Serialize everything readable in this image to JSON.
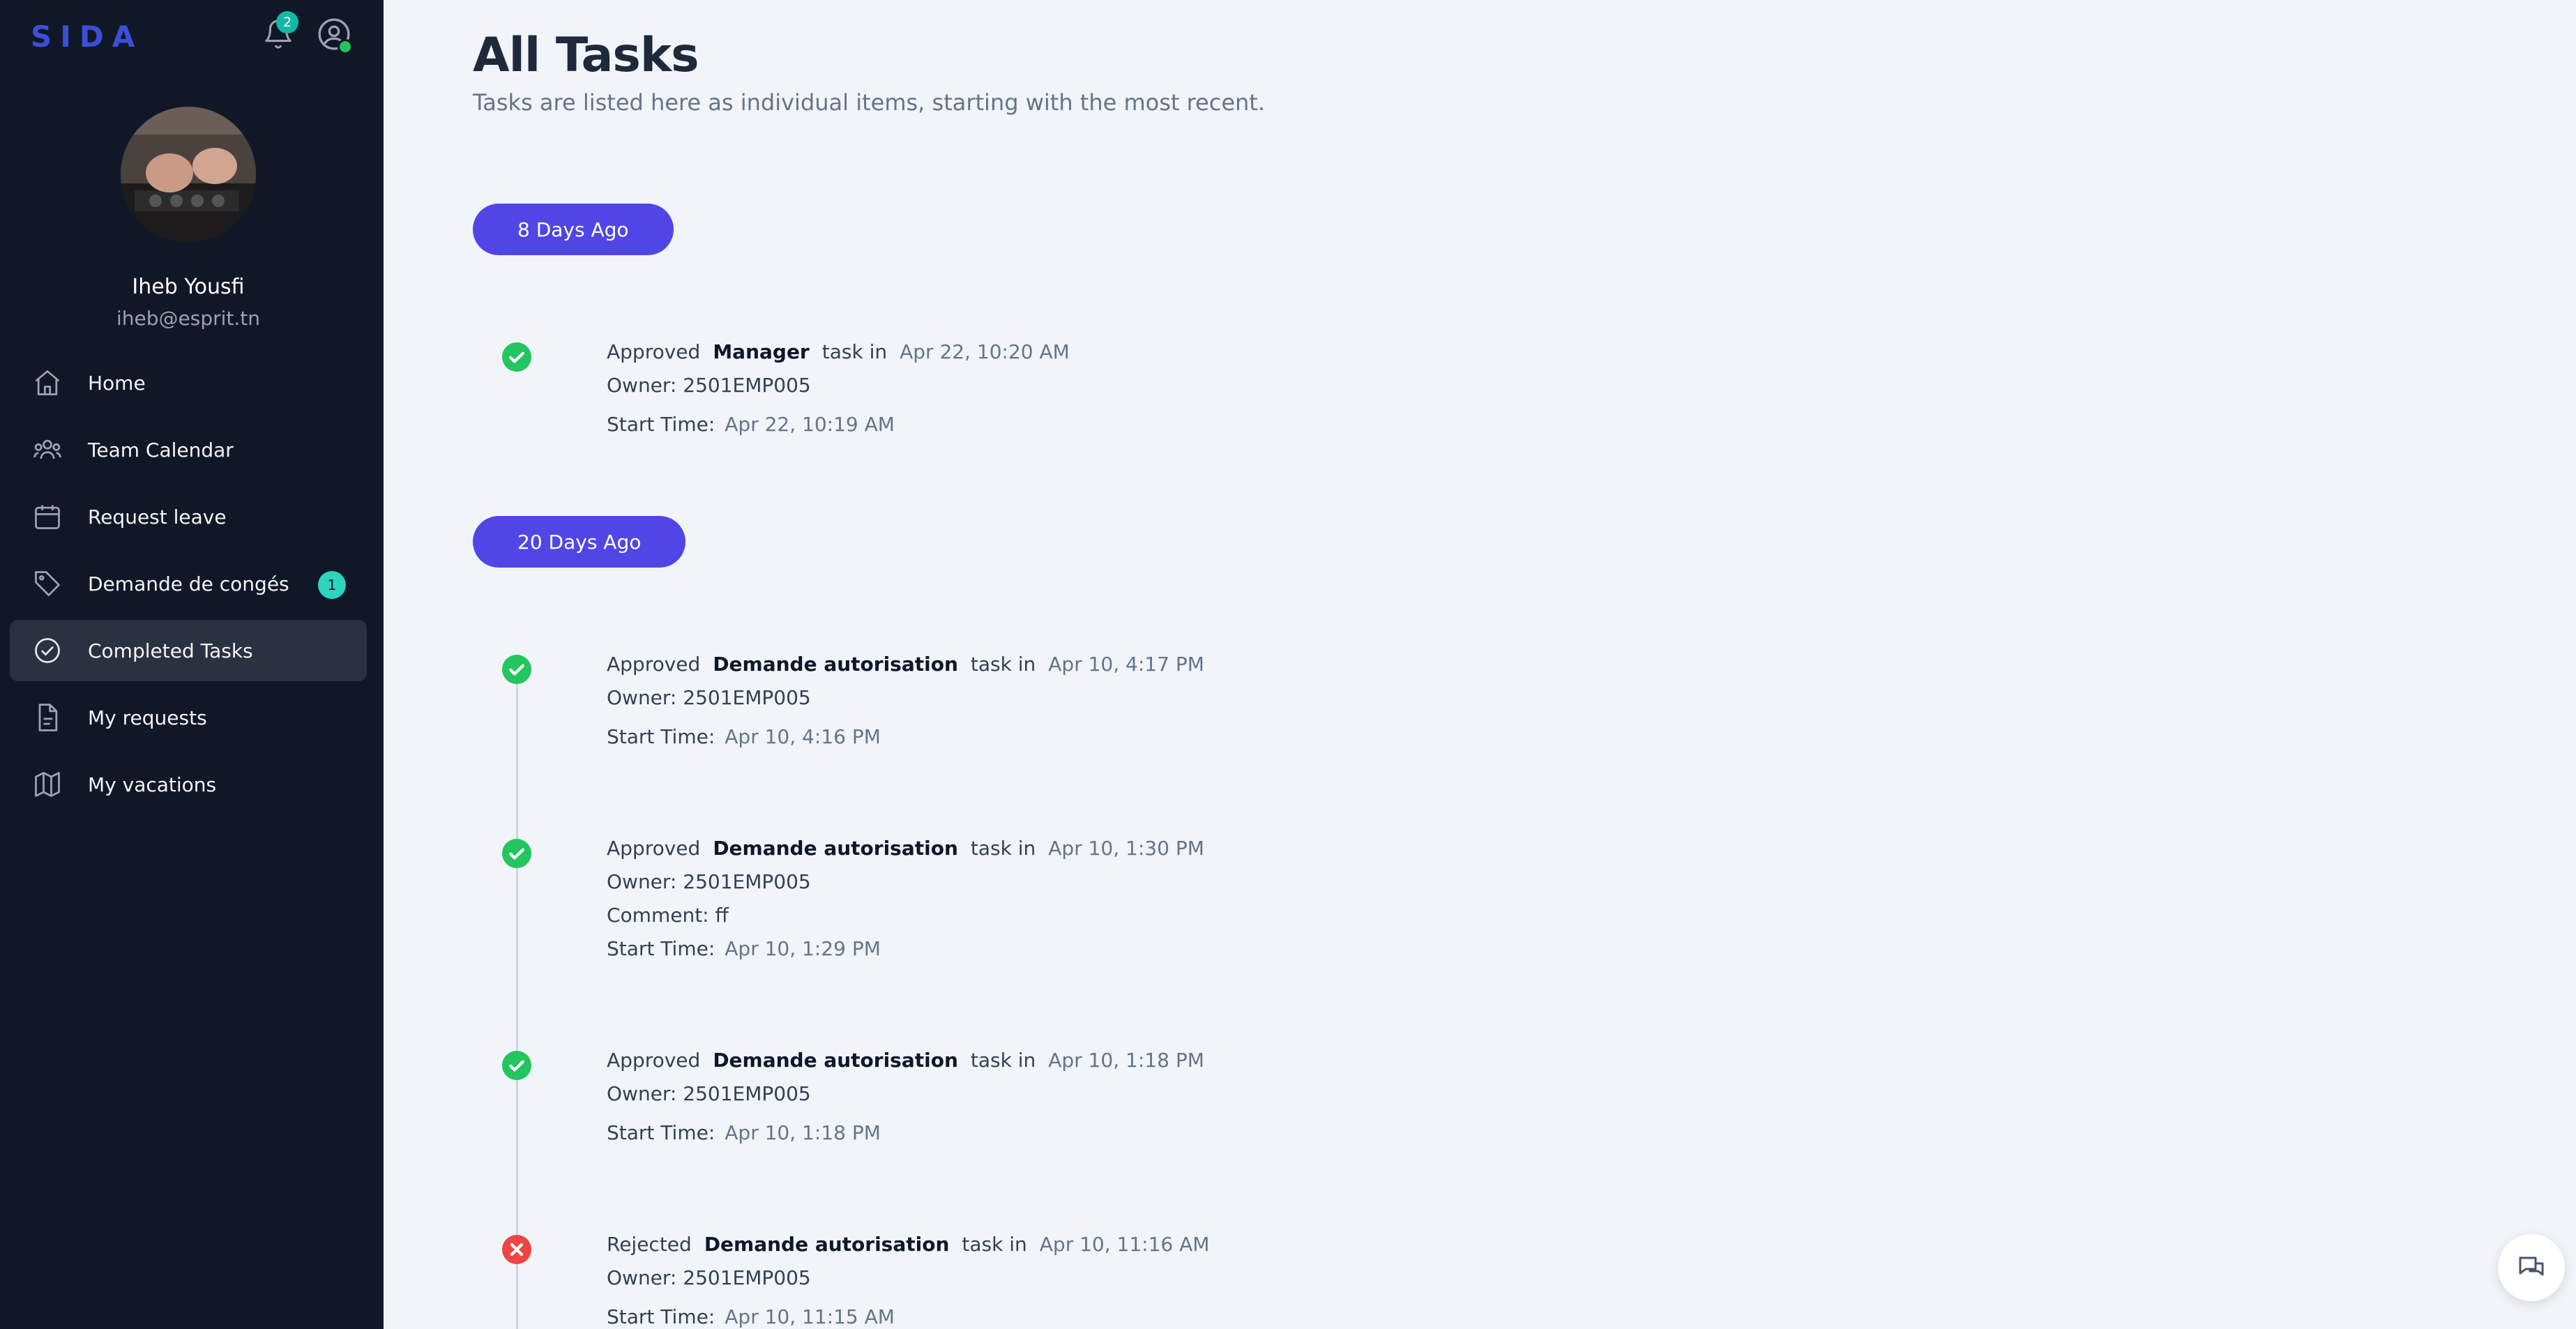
{
  "app": {
    "logo": "SIDA",
    "notifications_count": "2"
  },
  "user": {
    "name": "Iheb Yousfi",
    "email": "iheb@esprit.tn"
  },
  "nav": [
    {
      "label": "Home",
      "icon": "home-icon"
    },
    {
      "label": "Team Calendar",
      "icon": "team-icon"
    },
    {
      "label": "Request leave",
      "icon": "calendar-icon"
    },
    {
      "label": "Demande de congés",
      "icon": "tag-icon",
      "badge": "1"
    },
    {
      "label": "Completed Tasks",
      "icon": "check-circle-icon",
      "active": true
    },
    {
      "label": "My requests",
      "icon": "document-icon"
    },
    {
      "label": "My vacations",
      "icon": "map-icon"
    }
  ],
  "page": {
    "title": "All Tasks",
    "subtitle": "Tasks are listed here as individual items, starting with the most recent."
  },
  "groups": [
    {
      "label": "8 Days Ago",
      "tasks": [
        {
          "status": "approved",
          "action": "Approved",
          "type": "Manager",
          "in_label": "task in",
          "time": "Apr 22, 10:20 AM",
          "owner": "Owner: 2501EMP005",
          "start_label": "Start Time:",
          "start": "Apr 22, 10:19 AM"
        }
      ]
    },
    {
      "label": "20 Days Ago",
      "tasks": [
        {
          "status": "approved",
          "action": "Approved",
          "type": "Demande autorisation",
          "in_label": "task in",
          "time": "Apr 10, 4:17 PM",
          "owner": "Owner: 2501EMP005",
          "start_label": "Start Time:",
          "start": "Apr 10, 4:16 PM"
        },
        {
          "status": "approved",
          "action": "Approved",
          "type": "Demande autorisation",
          "in_label": "task in",
          "time": "Apr 10, 1:30 PM",
          "owner": "Owner: 2501EMP005",
          "comment": "Comment: ff",
          "start_label": "Start Time:",
          "start": "Apr 10, 1:29 PM"
        },
        {
          "status": "approved",
          "action": "Approved",
          "type": "Demande autorisation",
          "in_label": "task in",
          "time": "Apr 10, 1:18 PM",
          "owner": "Owner: 2501EMP005",
          "start_label": "Start Time:",
          "start": "Apr 10, 1:18 PM"
        },
        {
          "status": "rejected",
          "action": "Rejected",
          "type": "Demande autorisation",
          "in_label": "task in",
          "time": "Apr 10, 11:16 AM",
          "owner": "Owner: 2501EMP005",
          "start_label": "Start Time:",
          "start": "Apr 10, 11:15 AM"
        }
      ]
    }
  ],
  "colors": {
    "sidebar": "#101828",
    "accent": "#4f46e5",
    "approved": "#22c55e",
    "rejected": "#ef4444",
    "badge": "#14b8a6"
  }
}
